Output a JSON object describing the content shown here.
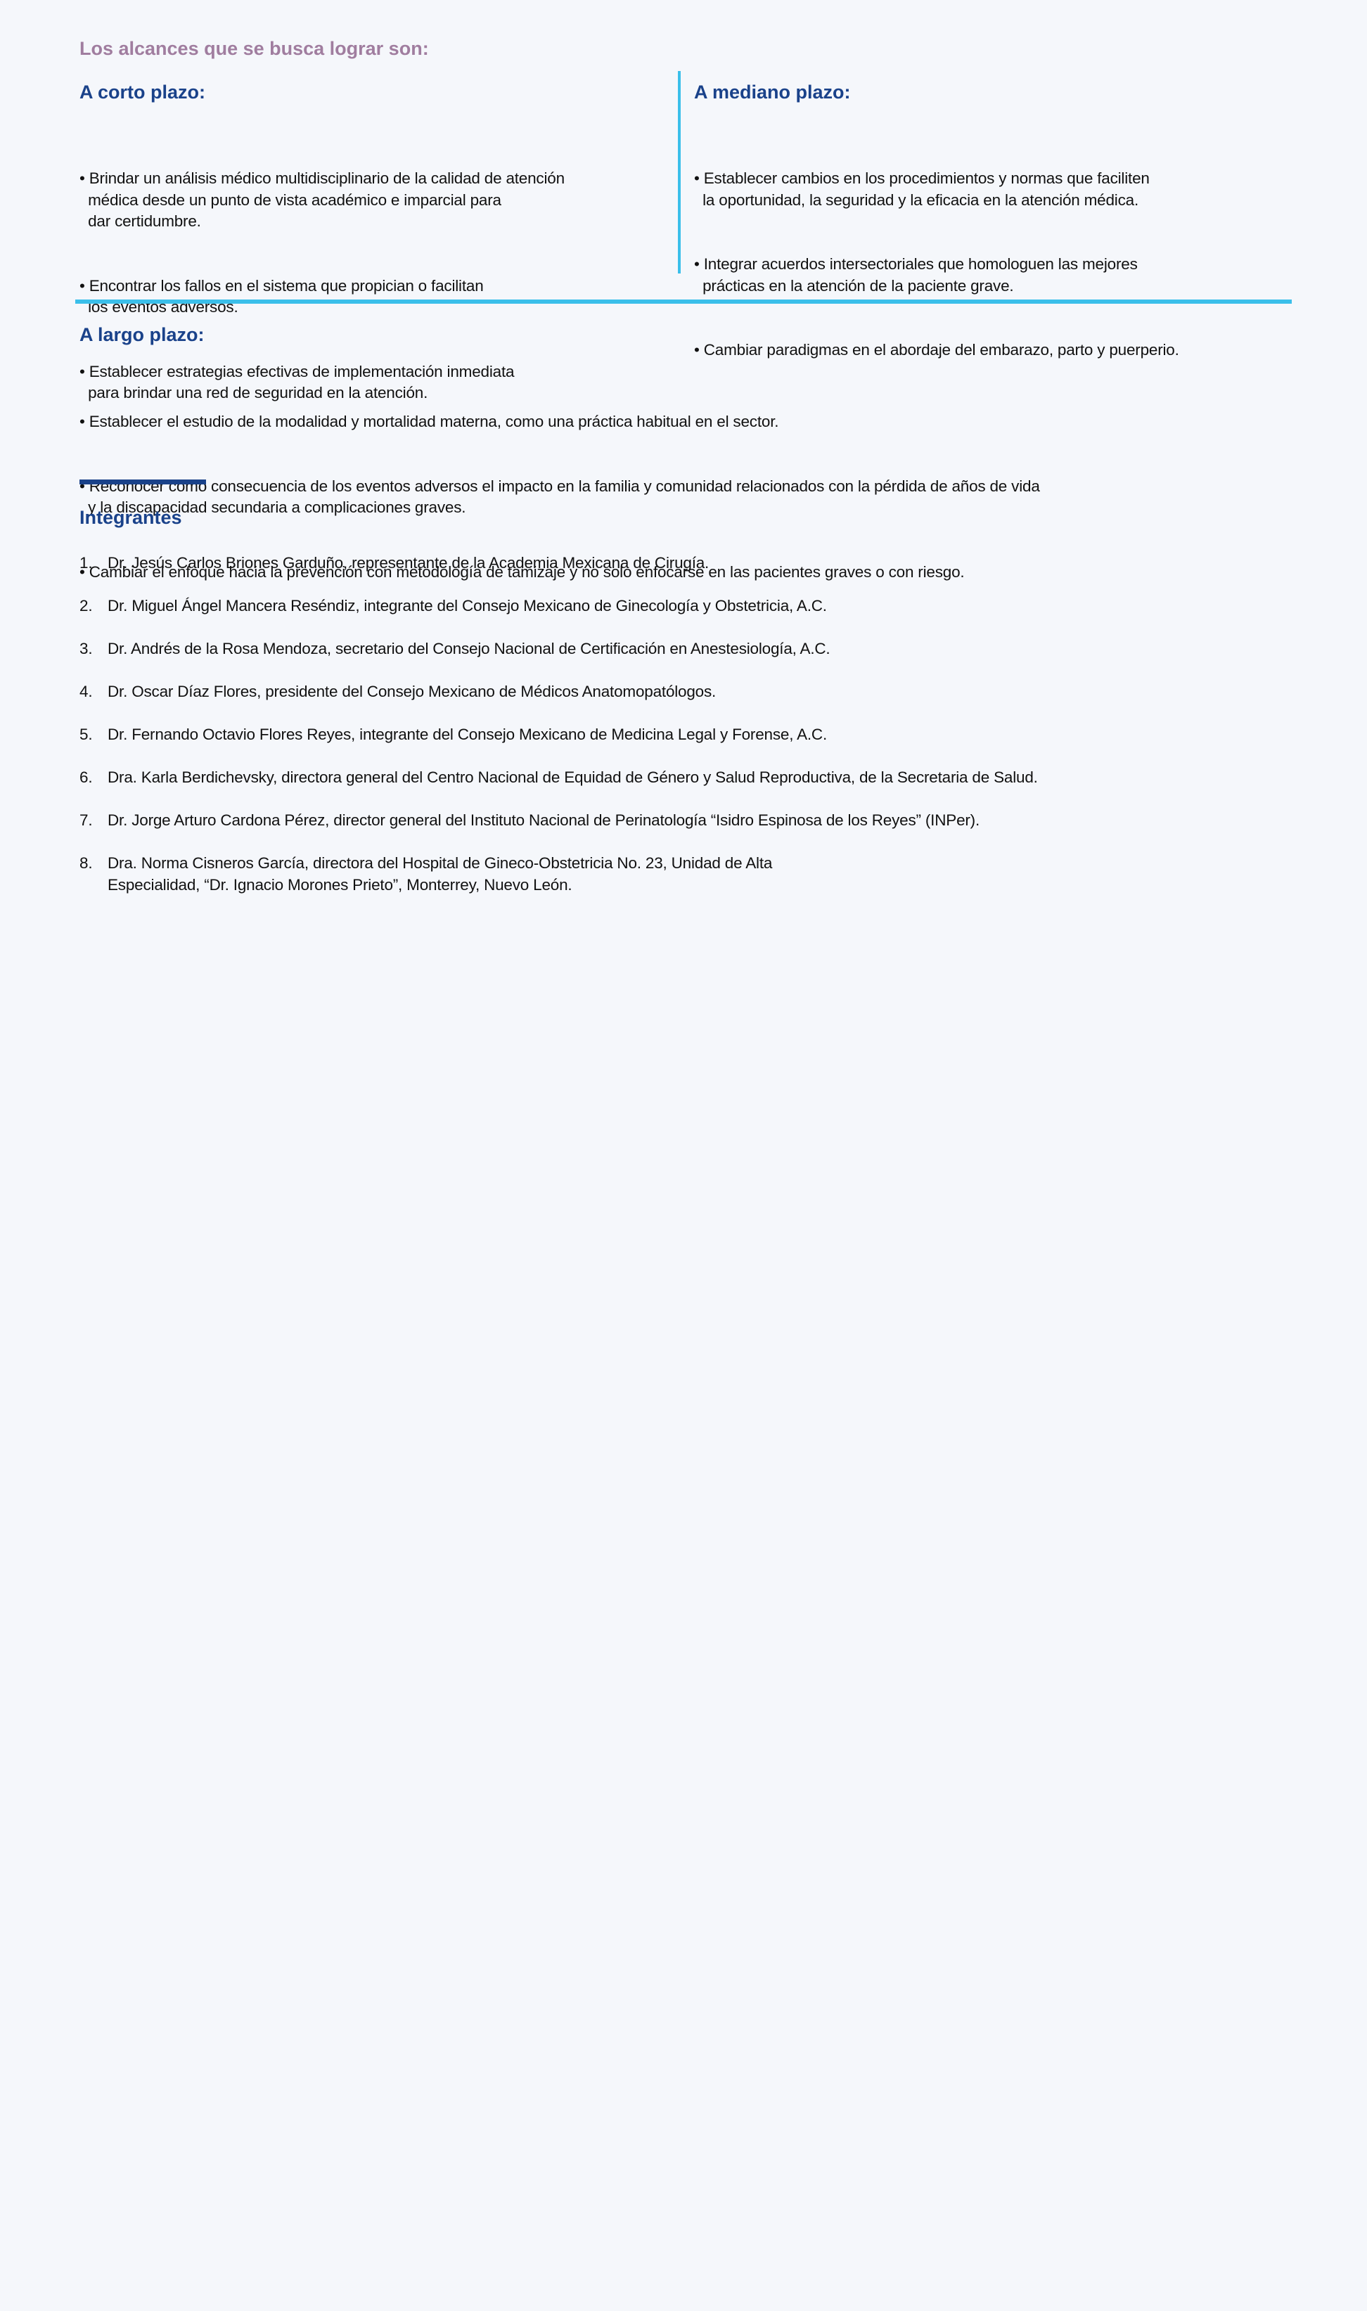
{
  "title": "Los alcances que se busca lograr son:",
  "corto": {
    "heading": "A corto plazo:",
    "bullets": [
      "• Brindar un análisis médico multidisciplinario de la calidad de atención\n  médica desde un punto de vista académico e imparcial para\n  dar certidumbre.",
      "• Encontrar los fallos en el sistema que propician o facilitan\n  los eventos adversos.",
      "• Establecer estrategias efectivas de implementación inmediata\n  para brindar una red de seguridad en la atención."
    ]
  },
  "mediano": {
    "heading": "A mediano plazo:",
    "bullets": [
      "• Establecer cambios en los procedimientos y normas que faciliten\n  la oportunidad, la seguridad y la eficacia en la atención médica.",
      "• Integrar acuerdos intersectoriales que homologuen las mejores\n  prácticas en la atención de la paciente grave.",
      "• Cambiar paradigmas en el abordaje del embarazo, parto y puerperio."
    ]
  },
  "largo": {
    "heading": "A largo plazo:",
    "bullets": [
      "• Establecer el estudio de la modalidad y mortalidad materna, como una práctica habitual en el sector.",
      "• Reconocer como consecuencia de los eventos adversos el impacto en la familia y comunidad relacionados con la pérdida de años de vida\n  y la discapacidad secundaria a complicaciones graves.",
      "• Cambiar el enfoque hacia la prevención con metodología de tamizaje y no solo enfocarse en las pacientes graves o con riesgo."
    ]
  },
  "integrantes": {
    "heading": "Integrantes",
    "items": [
      {
        "num": "1.",
        "text": "Dr. Jesús Carlos Briones Garduño, representante de la Academia Mexicana de Cirugía."
      },
      {
        "num": "2.",
        "text": "Dr. Miguel Ángel Mancera Reséndiz, integrante del Consejo Mexicano de Ginecología y Obstetricia, A.C."
      },
      {
        "num": "3.",
        "text": "Dr. Andrés de la Rosa Mendoza, secretario del Consejo Nacional de Certificación en Anestesiología, A.C."
      },
      {
        "num": "4.",
        "text": "Dr. Oscar Díaz Flores, presidente del Consejo Mexicano de Médicos Anatomopatólogos."
      },
      {
        "num": "5.",
        "text": "Dr. Fernando Octavio Flores Reyes, integrante del Consejo Mexicano de Medicina Legal y Forense, A.C."
      },
      {
        "num": "6.",
        "text": "Dra. Karla Berdichevsky, directora general del Centro Nacional de Equidad de Género y Salud Reproductiva, de la Secretaria de Salud."
      },
      {
        "num": "7.",
        "text": "Dr. Jorge Arturo Cardona Pérez, director general del Instituto Nacional de Perinatología “Isidro Espinosa de los Reyes” (INPer)."
      },
      {
        "num": "8.",
        "text": "Dra. Norma Cisneros García, directora del Hospital de Gineco-Obstetricia No. 23, Unidad de Alta\nEspecialidad, “Dr. Ignacio Morones Prieto”, Monterrey, Nuevo León."
      }
    ]
  },
  "colors": {
    "title": "#a07d9f",
    "heading": "#1a428a",
    "accent_line": "#3bbfea",
    "background": "#f5f7fb"
  }
}
